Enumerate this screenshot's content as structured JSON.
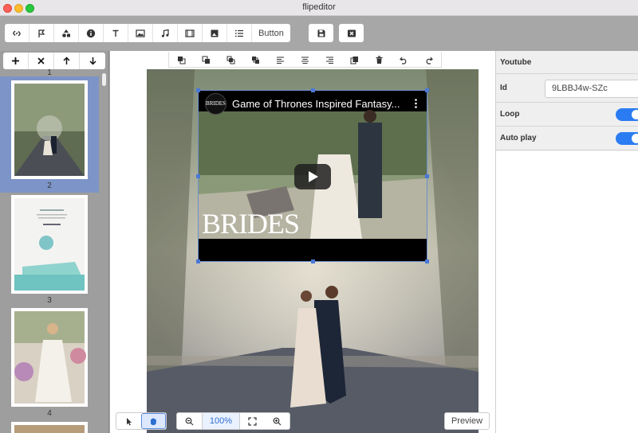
{
  "window": {
    "title": "flipeditor"
  },
  "toolbar": {
    "tools": [
      "link-icon",
      "bookmark-icon",
      "shapes-icon",
      "info-icon",
      "text-icon",
      "image-icon",
      "music-icon",
      "video-icon",
      "photo-icon",
      "list-icon"
    ],
    "button_label": "Button",
    "save_icon": "save-icon",
    "close_icon": "close-box-icon"
  },
  "pages": {
    "tools": [
      "add-icon",
      "remove-icon",
      "move-up-icon",
      "move-down-icon"
    ],
    "items": [
      {
        "label": "1"
      },
      {
        "label": "2",
        "selected": true
      },
      {
        "label": "3"
      },
      {
        "label": "4"
      }
    ]
  },
  "canvas": {
    "tools": [
      "bring-front-icon",
      "send-back-icon",
      "bring-forward-icon",
      "send-backward-icon",
      "align-left-icon",
      "align-center-icon",
      "align-right-icon",
      "duplicate-icon",
      "delete-icon",
      "undo-icon",
      "redo-icon"
    ]
  },
  "video": {
    "channel_logo": "BRIDES",
    "title": "Game of Thrones Inspired Fantasy...",
    "brand_overlay": "BRIDES"
  },
  "bottom_bar": {
    "zoom": "100%",
    "preview_label": "Preview"
  },
  "properties": {
    "section": "Youtube",
    "id_label": "Id",
    "id_value": "9LBBJ4w-SZc",
    "loop_label": "Loop",
    "loop_on": true,
    "autoplay_label": "Auto play",
    "autoplay_on": true
  },
  "colors": {
    "accent": "#2b7cf3",
    "selection": "#7c94c7",
    "toolbar_bg": "#a7a7a7"
  }
}
